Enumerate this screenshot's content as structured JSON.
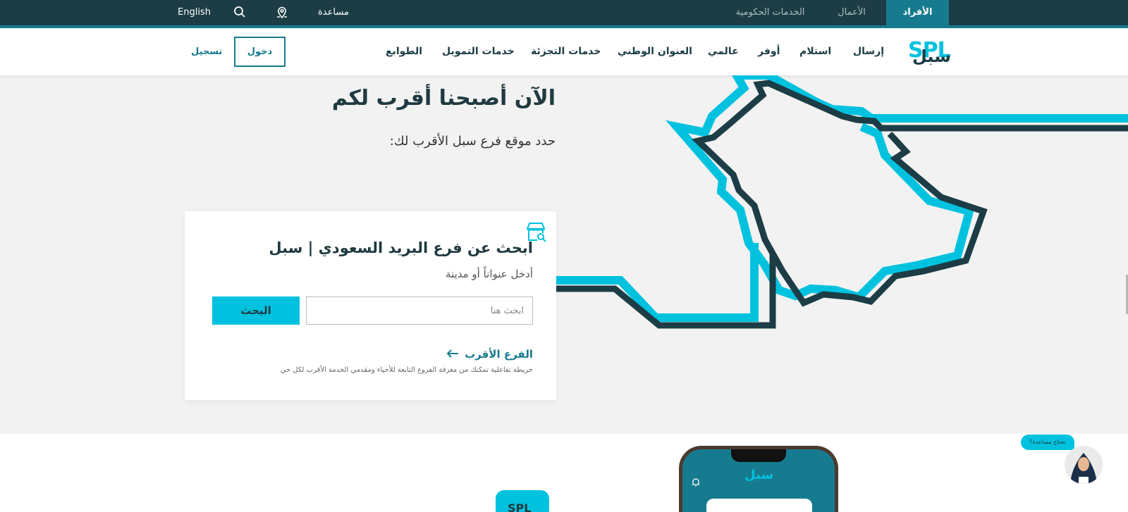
{
  "topbar": {
    "segments": [
      {
        "label": "الأفراد",
        "active": true
      },
      {
        "label": "الأعمال",
        "active": false
      },
      {
        "label": "الخدمات الحكومية",
        "active": false
      }
    ],
    "help_label": "مساعدة",
    "language_label": "English",
    "icons": {
      "location": "location-pin-icon",
      "search": "search-icon"
    }
  },
  "nav": {
    "logo": {
      "latin": "SPL",
      "arabic": "سبل"
    },
    "items": [
      "إرسال",
      "استلام",
      "أوفر",
      "عالمي",
      "العنوان الوطني",
      "خدمات التجزئة",
      "خدمات التمويل",
      "الطوابع"
    ],
    "login_label": "دخول",
    "register_label": "تسجيل"
  },
  "hero": {
    "title": "الآن أصبحنا أقرب لكم",
    "subtitle": "حدد موقع فرع سبل الأقرب لك:"
  },
  "search_card": {
    "title": "ابحث عن فرع البريد السعودي | سبل",
    "subtitle": "أدخل عنواناً أو مدينة",
    "input_placeholder": "ابحث هنا",
    "input_value": "",
    "search_button": "البحث",
    "nearest_link": "الفرع الأقرب",
    "nearest_description": "خريطة تفاعلية تمكنك من معرفة الفروع التابعة للأحياء ومقدمي الخدمة الأقرب لكل حي"
  },
  "app_promo": {
    "phone_logo": "سبل",
    "badge_text": "SPL"
  },
  "help_widget": {
    "bubble_text": "تحتاج مساعدة؟"
  },
  "colors": {
    "dark_teal": "#1c3d45",
    "teal": "#177b8f",
    "cyan": "#00c2df",
    "background": "#f2f2f2"
  }
}
